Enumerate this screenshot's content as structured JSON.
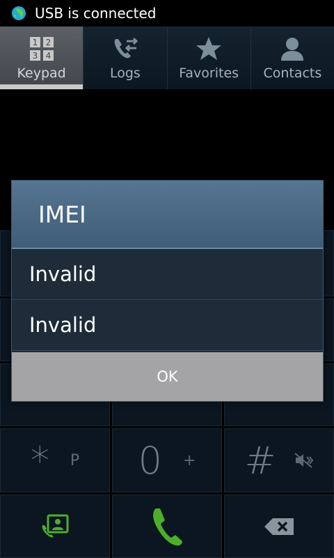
{
  "status_bar": {
    "text": "USB is connected"
  },
  "tabs": [
    {
      "label": "Keypad",
      "active": true
    },
    {
      "label": "Logs",
      "active": false
    },
    {
      "label": "Favorites",
      "active": false
    },
    {
      "label": "Contacts",
      "active": false
    }
  ],
  "keypad": {
    "row4": {
      "star": {
        "main": "*",
        "sub": "P"
      },
      "zero": {
        "main": "0",
        "sub": "+"
      },
      "hash": {
        "main": "#"
      }
    }
  },
  "dialog": {
    "title": "IMEI",
    "rows": [
      "Invalid",
      "Invalid"
    ],
    "ok_label": "OK"
  },
  "colors": {
    "call_green": "#4caf2b",
    "dialog_title": "#4d6b88",
    "ok_button": "#a4a4a6"
  }
}
